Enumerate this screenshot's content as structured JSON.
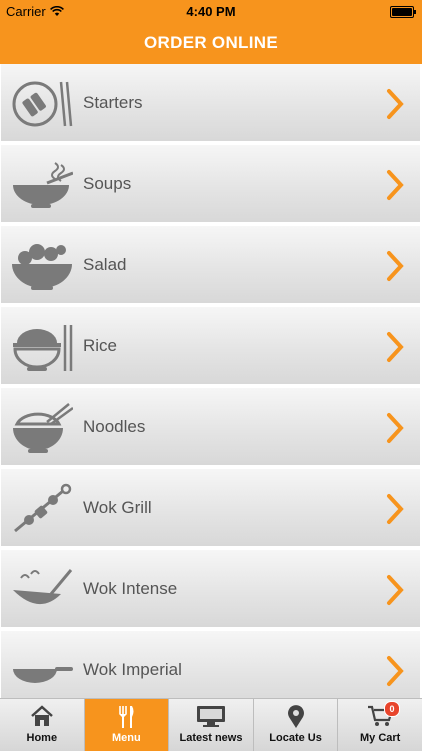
{
  "status_bar": {
    "carrier": "Carrier",
    "time": "4:40 PM"
  },
  "header": {
    "title": "ORDER ONLINE"
  },
  "menu": {
    "items": [
      {
        "label": "Starters",
        "icon": "starters-icon"
      },
      {
        "label": "Soups",
        "icon": "soup-bowl-icon"
      },
      {
        "label": "Salad",
        "icon": "salad-bowl-icon"
      },
      {
        "label": "Rice",
        "icon": "rice-bowl-icon"
      },
      {
        "label": "Noodles",
        "icon": "noodles-bowl-icon"
      },
      {
        "label": "Wok Grill",
        "icon": "skewer-icon"
      },
      {
        "label": "Wok Intense",
        "icon": "wok-toss-icon"
      },
      {
        "label": "Wok Imperial",
        "icon": "wok-pan-icon"
      }
    ]
  },
  "tabbar": {
    "tabs": [
      {
        "label": "Home",
        "icon": "home-icon"
      },
      {
        "label": "Menu",
        "icon": "cutlery-icon",
        "active": true
      },
      {
        "label": "Latest news",
        "icon": "monitor-icon"
      },
      {
        "label": "Locate Us",
        "icon": "map-pin-icon"
      },
      {
        "label": "My Cart",
        "icon": "cart-icon",
        "badge": "0"
      }
    ]
  },
  "colors": {
    "accent": "#f7941d",
    "icon_gray": "#7a7a7a",
    "badge": "#e8452c"
  }
}
